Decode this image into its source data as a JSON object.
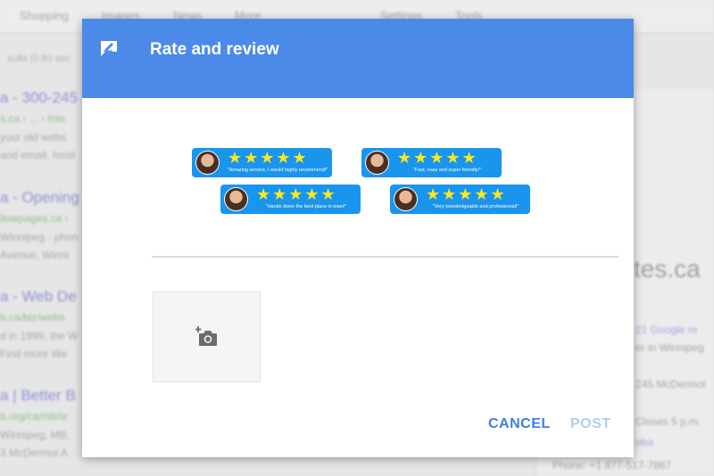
{
  "background": {
    "nav": [
      "Shopping",
      "Images",
      "News",
      "More",
      "Settings",
      "Tools"
    ],
    "stats": "sults (0.60 sec",
    "results": [
      {
        "title": "a - 300-245",
        "url": "s.ca › ... › Inte",
        "snippet1": "your old webs",
        "snippet2": "and email, hosti"
      },
      {
        "title": "a - Opening",
        "url": "llowpages.ca ›",
        "snippet1": "Winnipeg - phon",
        "snippet2": "Avenue, Winni"
      },
      {
        "title": "a - Web De",
        "url": "b.ca/biz/webs",
        "snippet1": "d in 1999, the W",
        "snippet2": "Find more We"
      },
      {
        "title": "a | Better B",
        "url": "b.org/ca/mb/w",
        "snippet1": "Winnipeg, MB,",
        "snippet2": "3 McDermot A"
      }
    ],
    "panel": {
      "title": "tes.ca",
      "reviews": "21 Google re",
      "location": "er in Winnipeg",
      "address": "245 McDermot",
      "hours": "Closes 5 p.m.",
      "link": "oba",
      "phone": "Phone: +1 877-517-7867"
    }
  },
  "modal": {
    "title": "Rate and review",
    "header_icon": "edit-review-icon",
    "reviews": [
      {
        "stars": "★★★★★",
        "rating": 5,
        "quote": "\"Amazing service, I would highly recommend!\""
      },
      {
        "stars": "★★★★★",
        "rating": 5,
        "quote": "\"Fast, easy and super friendly!\""
      },
      {
        "stars": "★★★★★",
        "rating": 5,
        "quote": "\"Hands down the best place in town!\""
      },
      {
        "stars": "★★★★★",
        "rating": 5,
        "quote": "\"Very knowledgeable and professional!\""
      }
    ],
    "photo_icon": "add-photo-icon",
    "cancel_label": "CANCEL",
    "post_label": "POST"
  },
  "colors": {
    "header": "#4b8ae8",
    "pill": "#1a95ee",
    "star": "#ffe81a",
    "cancel": "#3e7fe0",
    "post_disabled": "#b2cdf3"
  }
}
